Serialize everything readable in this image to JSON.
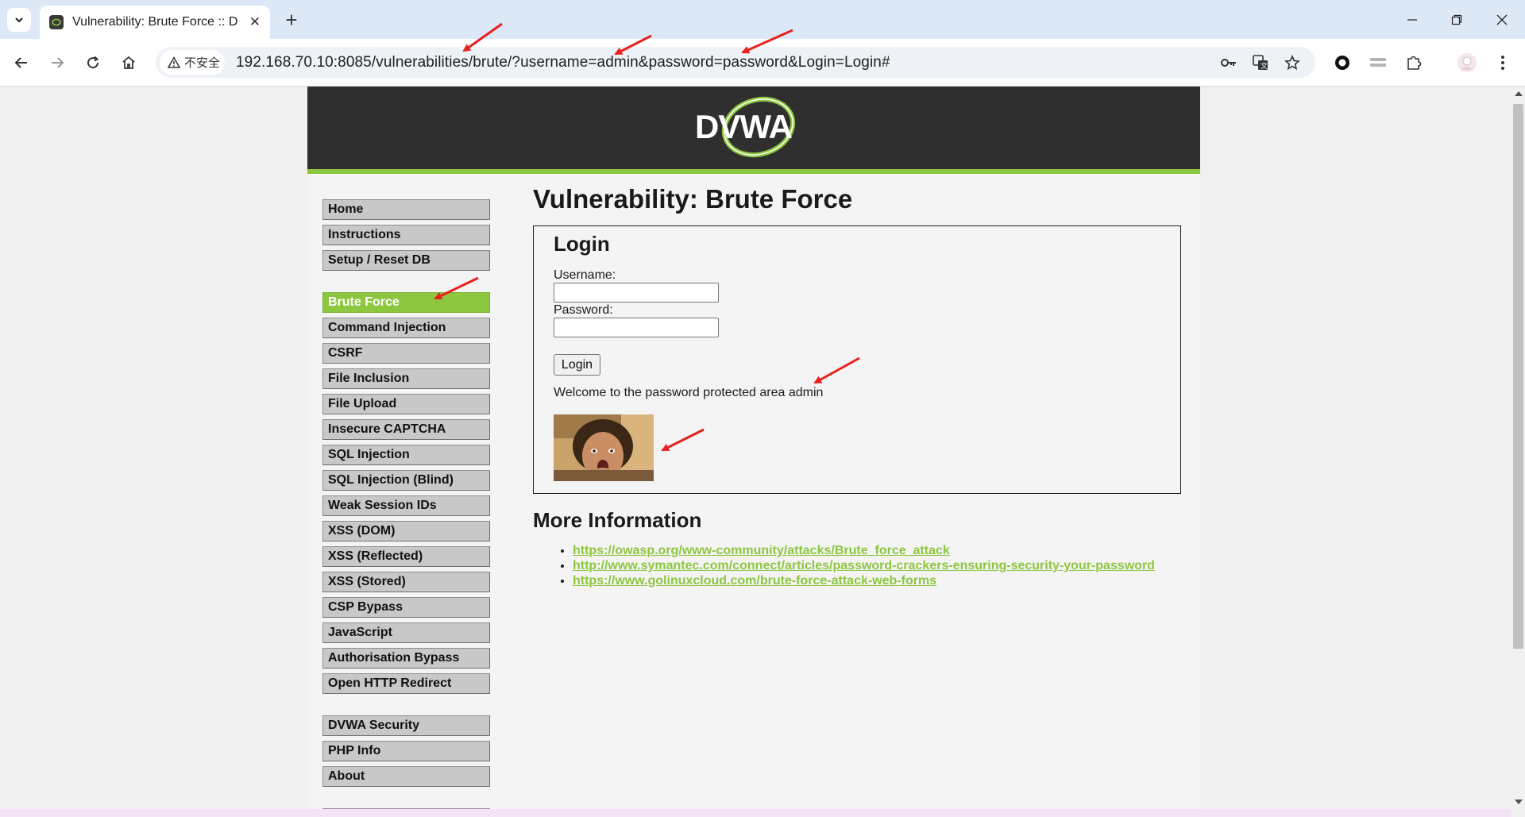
{
  "browser": {
    "tab_title": "Vulnerability: Brute Force :: D",
    "security_label": "不安全",
    "url": "192.168.70.10:8085/vulnerabilities/brute/?username=admin&password=password&Login=Login#"
  },
  "header": {
    "logo_text": "DVWA"
  },
  "sidebar": {
    "group1": [
      {
        "label": "Home"
      },
      {
        "label": "Instructions"
      },
      {
        "label": "Setup / Reset DB"
      }
    ],
    "group2": [
      {
        "label": "Brute Force",
        "selected": true
      },
      {
        "label": "Command Injection"
      },
      {
        "label": "CSRF"
      },
      {
        "label": "File Inclusion"
      },
      {
        "label": "File Upload"
      },
      {
        "label": "Insecure CAPTCHA"
      },
      {
        "label": "SQL Injection"
      },
      {
        "label": "SQL Injection (Blind)"
      },
      {
        "label": "Weak Session IDs"
      },
      {
        "label": "XSS (DOM)"
      },
      {
        "label": "XSS (Reflected)"
      },
      {
        "label": "XSS (Stored)"
      },
      {
        "label": "CSP Bypass"
      },
      {
        "label": "JavaScript"
      },
      {
        "label": "Authorisation Bypass"
      },
      {
        "label": "Open HTTP Redirect"
      }
    ],
    "group3": [
      {
        "label": "DVWA Security"
      },
      {
        "label": "PHP Info"
      },
      {
        "label": "About"
      }
    ]
  },
  "main": {
    "title": "Vulnerability: Brute Force",
    "login": {
      "heading": "Login",
      "username_label": "Username:",
      "password_label": "Password:",
      "username_value": "",
      "password_value": "",
      "button_label": "Login",
      "welcome_text": "Welcome to the password protected area admin"
    },
    "more_info": {
      "heading": "More Information",
      "links": [
        "https://owasp.org/www-community/attacks/Brute_force_attack",
        "http://www.symantec.com/connect/articles/password-crackers-ensuring-security-your-password",
        "https://www.golinuxcloud.com/brute-force-attack-web-forms"
      ]
    }
  },
  "colors": {
    "accent_green": "#8dc63f",
    "header_dark": "#2f2f2f",
    "annotation_red": "#e8211e"
  }
}
